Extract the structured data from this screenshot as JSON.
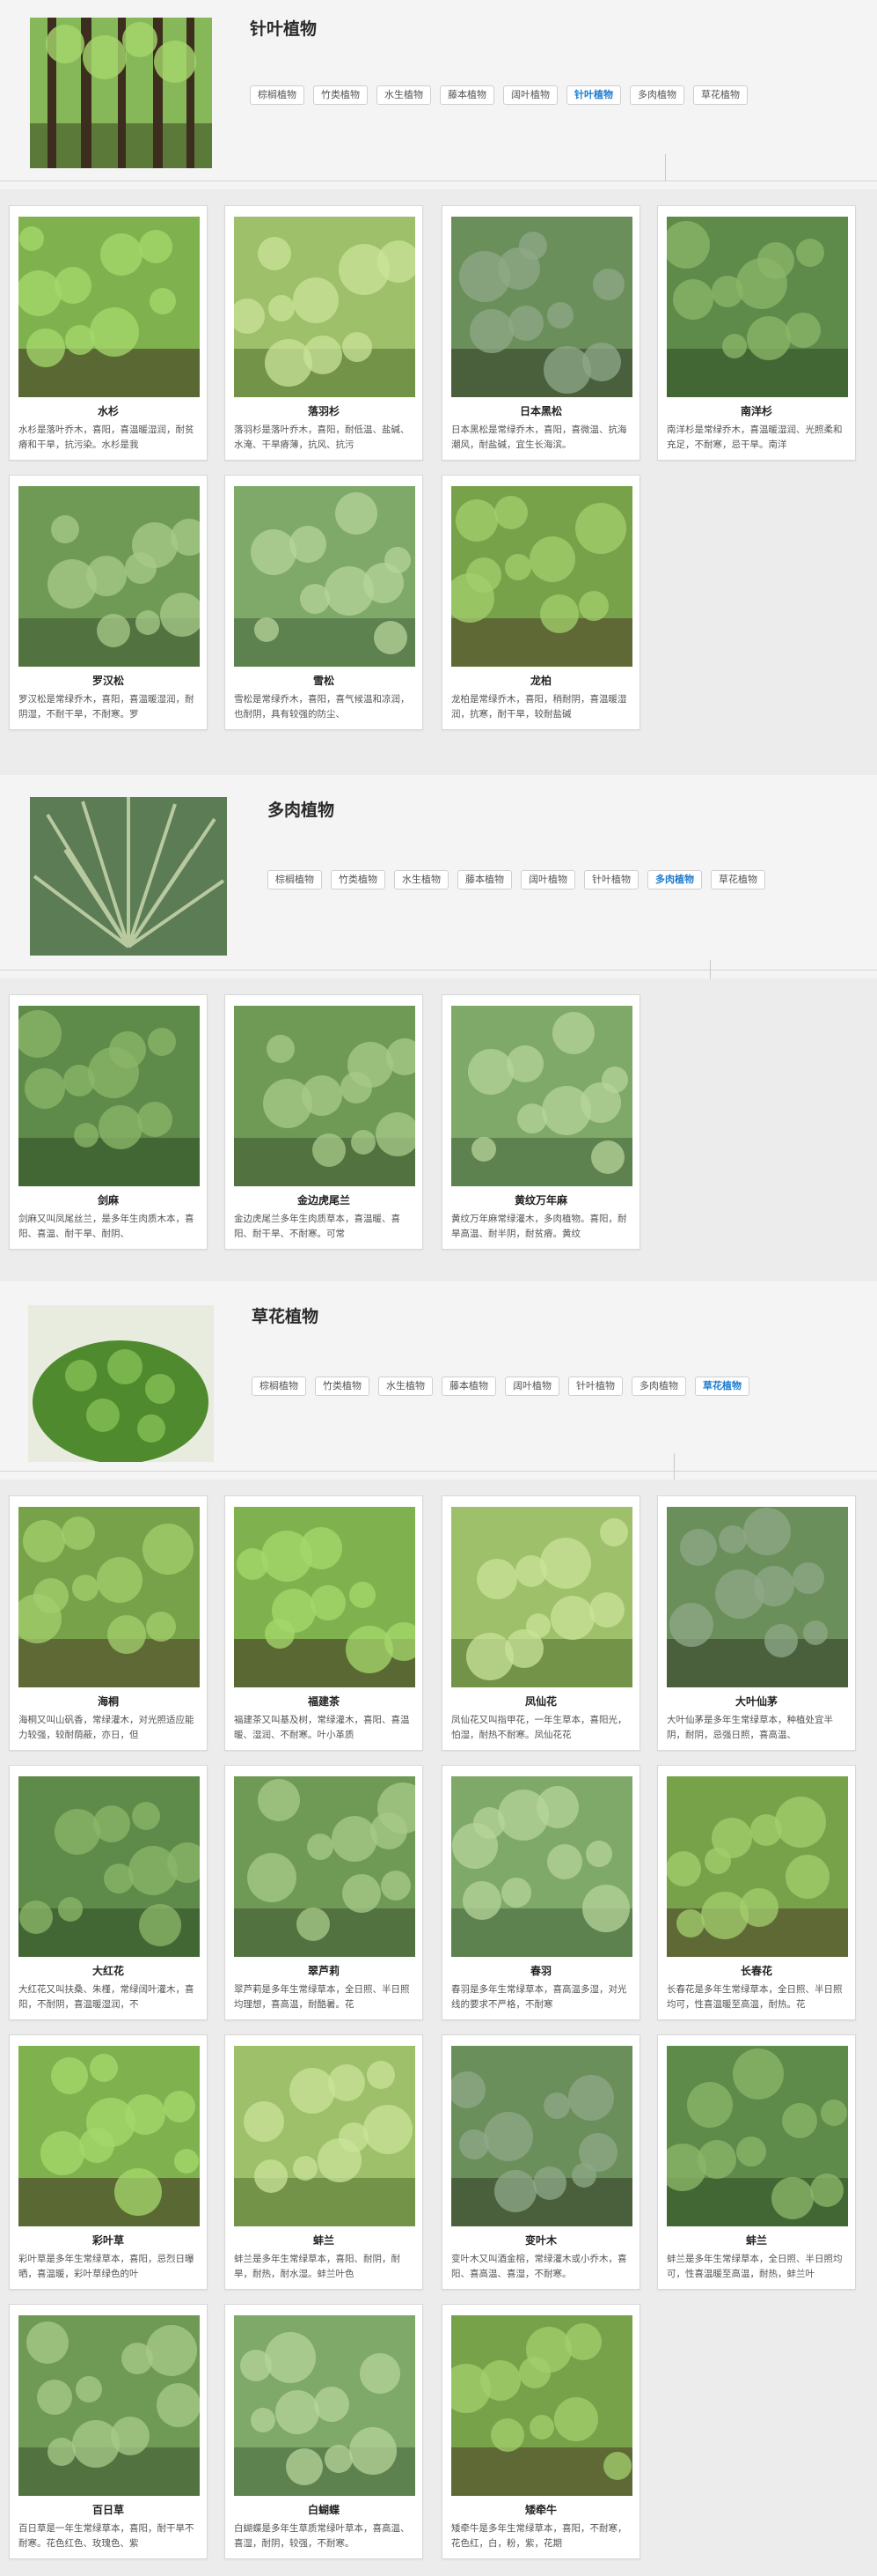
{
  "tabs": [
    "棕榈植物",
    "竹类植物",
    "水生植物",
    "藤本植物",
    "阔叶植物",
    "针叶植物",
    "多肉植物",
    "草花植物"
  ],
  "sections": [
    {
      "title": "针叶植物",
      "active_tab": 5,
      "plants": [
        {
          "name": "水杉",
          "desc": "水杉是落叶乔木，喜阳，喜温暖湿润，耐贫瘠和干旱，抗污染。水杉是我"
        },
        {
          "name": "落羽杉",
          "desc": "落羽杉是落叶乔木，喜阳，耐低温、盐碱、水淹、干旱瘠薄，抗风、抗污"
        },
        {
          "name": "日本黑松",
          "desc": "日本黑松是常绿乔木，喜阳，喜微温、抗海潮风，耐盐碱，宜生长海滨。"
        },
        {
          "name": "南洋杉",
          "desc": "南洋杉是常绿乔木，喜温暖湿润、光照柔和充足，不耐寒，忌干旱。南洋"
        },
        {
          "name": "罗汉松",
          "desc": "罗汉松是常绿乔木，喜阳，喜温暖湿润，耐阴湿，不耐干旱，不耐寒。罗"
        },
        {
          "name": "雪松",
          "desc": "雪松是常绿乔木，喜阳，喜气候温和凉润，也耐阴，具有较强的防尘、"
        },
        {
          "name": "龙柏",
          "desc": "龙柏是常绿乔木，喜阳，稍耐阴，喜温暖湿润，抗寒，耐干旱，较耐盐碱"
        }
      ]
    },
    {
      "title": "多肉植物",
      "active_tab": 6,
      "plants": [
        {
          "name": "剑麻",
          "desc": "剑麻又叫凤尾丝兰，是多年生肉质木本，喜阳、喜温、耐干旱、耐阴、"
        },
        {
          "name": "金边虎尾兰",
          "desc": "金边虎尾兰多年生肉质草本，喜温暖、喜阳、耐干旱、不耐寒。可常"
        },
        {
          "name": "黄纹万年麻",
          "desc": "黄纹万年麻常绿灌木，多肉植物。喜阳，耐旱高温、耐半阴，耐贫瘠。黄纹"
        }
      ]
    },
    {
      "title": "草花植物",
      "active_tab": 7,
      "plants": [
        {
          "name": "海桐",
          "desc": "海桐又叫山矾香，常绿灌木，对光照适应能力较强，较耐荫蔽，亦日，但"
        },
        {
          "name": "福建茶",
          "desc": "福建茶又叫基及树，常绿灌木，喜阳、喜温暖、湿润、不耐寒。叶小革质"
        },
        {
          "name": "凤仙花",
          "desc": "凤仙花又叫指甲花，一年生草本，喜阳光，怕湿，耐热不耐寒。凤仙花花"
        },
        {
          "name": "大叶仙茅",
          "desc": "大叶仙茅是多年生常绿草本，种植处宜半阴，耐阴，忌强日照，喜高温、"
        },
        {
          "name": "大红花",
          "desc": "大红花又叫扶桑、朱槿，常绿阔叶灌木，喜阳，不耐阴，喜温暖湿润，不"
        },
        {
          "name": "翠芦莉",
          "desc": "翠芦莉是多年生常绿草本，全日照、半日照均理想，喜高温，耐酷暑。花"
        },
        {
          "name": "春羽",
          "desc": "春羽是多年生常绿草本，喜高温多湿，对光线的要求不严格，不耐寒"
        },
        {
          "name": "长春花",
          "desc": "长春花是多年生常绿草本，全日照、半日照均可，性喜温暖至高温，耐热。花"
        },
        {
          "name": "彩叶草",
          "desc": "彩叶草是多年生常绿草本，喜阳，忌烈日曝晒，喜温暖，彩叶草绿色的叶"
        },
        {
          "name": "蚌兰",
          "desc": "蚌兰是多年生常绿草本，喜阳、耐阴，耐旱，耐热，耐水湿。蚌兰叶色"
        },
        {
          "name": "变叶木",
          "desc": "变叶木又叫酒金榕，常绿灌木或小乔木，喜阳、喜高温、喜湿，不耐寒。"
        },
        {
          "name": "蚌兰",
          "desc": "蚌兰是多年生常绿草本，全日照、半日照均可，性喜温暖至高温，耐热，蚌兰叶"
        },
        {
          "name": "百日草",
          "desc": "百日草是一年生常绿草本，喜阳，耐干旱不耐寒。花色红色、玫瑰色、紫"
        },
        {
          "name": "白蝴蝶",
          "desc": "白蝴蝶是多年生草质常绿叶草本，喜高温、喜湿，耐阴，较强，不耐寒。"
        },
        {
          "name": "矮牵牛",
          "desc": "矮牵牛是多年生常绿草本，喜阳，不耐寒，花色红，白，粉，紫，花期"
        }
      ]
    }
  ],
  "colors": {
    "tab_active": "#1d7bd0",
    "background": "#f4f4f4",
    "panel": "#ececec"
  }
}
